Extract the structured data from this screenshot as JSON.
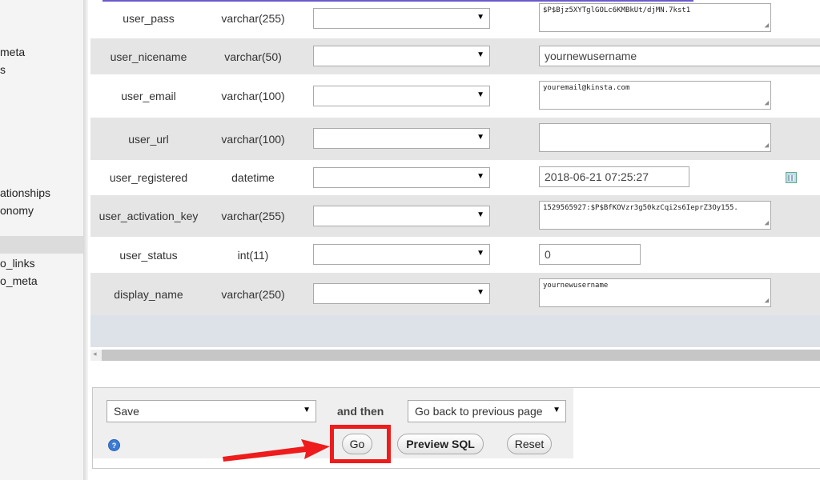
{
  "sidebar": {
    "items": [
      "meta",
      "s",
      "ationships",
      "onomy",
      "o_links",
      "o_meta"
    ]
  },
  "rows": [
    {
      "name": "user_pass",
      "type": "varchar(255)",
      "value": "$P$Bjz5XYTglGOLc6KMBkUt/djMN.7kst1",
      "kind": "textarea"
    },
    {
      "name": "user_nicename",
      "type": "varchar(50)",
      "value": "yournewusername",
      "kind": "input"
    },
    {
      "name": "user_email",
      "type": "varchar(100)",
      "value": "youremail@kinsta.com",
      "kind": "textarea"
    },
    {
      "name": "user_url",
      "type": "varchar(100)",
      "value": "",
      "kind": "textarea"
    },
    {
      "name": "user_registered",
      "type": "datetime",
      "value": "2018-06-21 07:25:27",
      "kind": "input"
    },
    {
      "name": "user_activation_key",
      "type": "varchar(255)",
      "value": "1529565927:$P$BfKOVzr3g50kzCqi2s6IeprZ3Oy155.",
      "kind": "textarea"
    },
    {
      "name": "user_status",
      "type": "int(11)",
      "value": "0",
      "kind": "input"
    },
    {
      "name": "display_name",
      "type": "varchar(250)",
      "value": "yournewusername",
      "kind": "textarea"
    }
  ],
  "form": {
    "action_select": "Save",
    "and_then_label": "and then",
    "after_select": "Go back to previous page",
    "go_button": "Go",
    "preview_button": "Preview SQL",
    "reset_button": "Reset"
  },
  "icons": {
    "select_arrow": "▼",
    "resize_grip": "◢",
    "scroll_left": "◂",
    "help": "?"
  },
  "colors": {
    "highlight": "#ee1c1c",
    "arrow": "#ee1c1c",
    "row_alt": "#e5e5e5"
  }
}
